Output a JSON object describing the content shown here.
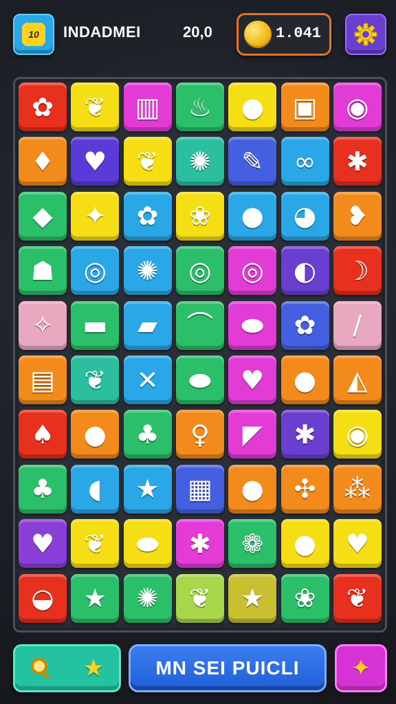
{
  "header": {
    "level_badge": "10",
    "player_name": "INDADMEI",
    "score": "20,0",
    "coins": "1.041"
  },
  "board": {
    "columns": 7,
    "rows": 10,
    "tiles": [
      [
        {
          "color": "#e8301e",
          "icon": "flower-icon",
          "glyph": "✿"
        },
        {
          "color": "#f5df14",
          "icon": "leaf-icon",
          "glyph": "❦"
        },
        {
          "color": "#e23bd6",
          "icon": "basket-icon",
          "glyph": "▥"
        },
        {
          "color": "#2bbf6a",
          "icon": "cupcake-icon",
          "glyph": "♨"
        },
        {
          "color": "#f5df14",
          "icon": "eggplant-icon",
          "glyph": "●"
        },
        {
          "color": "#f28a1c",
          "icon": "box-icon",
          "glyph": "▣"
        },
        {
          "color": "#e23bd6",
          "icon": "lemon-icon",
          "glyph": "◉"
        }
      ],
      [
        {
          "color": "#f28a1c",
          "icon": "radish-icon",
          "glyph": "♦"
        },
        {
          "color": "#5a3bd8",
          "icon": "heart-icon",
          "glyph": "♥"
        },
        {
          "color": "#f5df14",
          "icon": "leaf-icon",
          "glyph": "❦"
        },
        {
          "color": "#2bbfa0",
          "icon": "cookie-icon",
          "glyph": "✺"
        },
        {
          "color": "#4460e0",
          "icon": "popsicle-icon",
          "glyph": "✎"
        },
        {
          "color": "#2aa7e6",
          "icon": "pretzel-icon",
          "glyph": "∞"
        },
        {
          "color": "#e8301e",
          "icon": "maple-leaf-icon",
          "glyph": "✱"
        }
      ],
      [
        {
          "color": "#2bbf6a",
          "icon": "gem-icon",
          "glyph": "◆"
        },
        {
          "color": "#f5df14",
          "icon": "drumstick-icon",
          "glyph": "✦"
        },
        {
          "color": "#2aa7e6",
          "icon": "flower-icon",
          "glyph": "✿"
        },
        {
          "color": "#f5df14",
          "icon": "berries-icon",
          "glyph": "❀"
        },
        {
          "color": "#2aa7e6",
          "icon": "apple-icon",
          "glyph": "●"
        },
        {
          "color": "#2aa7e6",
          "icon": "lemon-icon",
          "glyph": "◕"
        },
        {
          "color": "#f28a1c",
          "icon": "peanuts-icon",
          "glyph": "❥"
        }
      ],
      [
        {
          "color": "#2bbf6a",
          "icon": "mushroom-icon",
          "glyph": "☗"
        },
        {
          "color": "#2aa7e6",
          "icon": "candy-icon",
          "glyph": "◎"
        },
        {
          "color": "#2aa7e6",
          "icon": "cauliflower-icon",
          "glyph": "✺"
        },
        {
          "color": "#2bbf6a",
          "icon": "donut-icon",
          "glyph": "◎"
        },
        {
          "color": "#e23bd6",
          "icon": "candy-icon",
          "glyph": "◎"
        },
        {
          "color": "#6a3fd0",
          "icon": "mirror-icon",
          "glyph": "◐"
        },
        {
          "color": "#e8301e",
          "icon": "bananas-icon",
          "glyph": "☽"
        }
      ],
      [
        {
          "color": "#e8a8c0",
          "icon": "star-fruit-icon",
          "glyph": "✧"
        },
        {
          "color": "#2bbf6a",
          "icon": "sushi-icon",
          "glyph": "▬"
        },
        {
          "color": "#2aa7e6",
          "icon": "cheese-icon",
          "glyph": "▰"
        },
        {
          "color": "#2bbf6a",
          "icon": "worm-candy-icon",
          "glyph": "⌒"
        },
        {
          "color": "#e23bd6",
          "icon": "lips-candy-icon",
          "glyph": "⬬"
        },
        {
          "color": "#4460e0",
          "icon": "egg-icon",
          "glyph": "✿"
        },
        {
          "color": "#e8a8c0",
          "icon": "stick-icon",
          "glyph": "∕"
        }
      ],
      [
        {
          "color": "#f28a1c",
          "icon": "jar-icon",
          "glyph": "▤"
        },
        {
          "color": "#2bbfa0",
          "icon": "leaf-icon",
          "glyph": "❦"
        },
        {
          "color": "#2aa7e6",
          "icon": "bandage-icon",
          "glyph": "✕"
        },
        {
          "color": "#2bbf6a",
          "icon": "plum-icon",
          "glyph": "⬬"
        },
        {
          "color": "#e23bd6",
          "icon": "heart-icon",
          "glyph": "♥"
        },
        {
          "color": "#f28a1c",
          "icon": "tomato-icon",
          "glyph": "●"
        },
        {
          "color": "#f28a1c",
          "icon": "cake-icon",
          "glyph": "◭"
        }
      ],
      [
        {
          "color": "#e8301e",
          "icon": "pepper-icon",
          "glyph": "♠"
        },
        {
          "color": "#f28a1c",
          "icon": "apple-icon",
          "glyph": "●"
        },
        {
          "color": "#2bbf6a",
          "icon": "sprout-icon",
          "glyph": "♣"
        },
        {
          "color": "#f28a1c",
          "icon": "lollipop-icon",
          "glyph": "♀"
        },
        {
          "color": "#e23bd6",
          "icon": "crystal-icon",
          "glyph": "◤"
        },
        {
          "color": "#6a3fd0",
          "icon": "maple-leaf-icon",
          "glyph": "✱"
        },
        {
          "color": "#f5df14",
          "icon": "avocado-icon",
          "glyph": "◉"
        }
      ],
      [
        {
          "color": "#2bbf6a",
          "icon": "sprout-icon",
          "glyph": "♣"
        },
        {
          "color": "#2aa7e6",
          "icon": "mango-icon",
          "glyph": "◖"
        },
        {
          "color": "#2aa7e6",
          "icon": "star-cookie-icon",
          "glyph": "★"
        },
        {
          "color": "#4460e0",
          "icon": "cracker-icon",
          "glyph": "▦"
        },
        {
          "color": "#f28a1c",
          "icon": "lemon-icon",
          "glyph": "●"
        },
        {
          "color": "#f28a1c",
          "icon": "leaf-icon",
          "glyph": "✣"
        },
        {
          "color": "#f28a1c",
          "icon": "grapes-icon",
          "glyph": "⁂"
        }
      ],
      [
        {
          "color": "#8a3fd8",
          "icon": "heart-icon",
          "glyph": "♥"
        },
        {
          "color": "#f5df14",
          "icon": "leaf-icon",
          "glyph": "❦"
        },
        {
          "color": "#f5df14",
          "icon": "lime-icon",
          "glyph": "⬬"
        },
        {
          "color": "#e23bd6",
          "icon": "maple-leaf-icon",
          "glyph": "✱"
        },
        {
          "color": "#2bbf6a",
          "icon": "berry-icon",
          "glyph": "❁"
        },
        {
          "color": "#f5df14",
          "icon": "lemon-icon",
          "glyph": "●"
        },
        {
          "color": "#f5df14",
          "icon": "strawberry-icon",
          "glyph": "♥"
        }
      ],
      [
        {
          "color": "#e8301e",
          "icon": "planet-icon",
          "glyph": "◒"
        },
        {
          "color": "#2bbf6a",
          "icon": "star-cookie-icon",
          "glyph": "★"
        },
        {
          "color": "#2bbf6a",
          "icon": "sunflower-icon",
          "glyph": "✺"
        },
        {
          "color": "#a8d84a",
          "icon": "leaf-icon",
          "glyph": "❦"
        },
        {
          "color": "#c8c030",
          "icon": "star-icon",
          "glyph": "★"
        },
        {
          "color": "#2bbf6a",
          "icon": "flowers-icon",
          "glyph": "❀"
        },
        {
          "color": "#e8301e",
          "icon": "feather-icon",
          "glyph": "❦"
        }
      ]
    ]
  },
  "footer": {
    "search_icon": "search-icon",
    "star_icon": "star-icon",
    "main_button_label": "MN SEI PUICLI",
    "hint_icon": "sparkle-icon"
  }
}
